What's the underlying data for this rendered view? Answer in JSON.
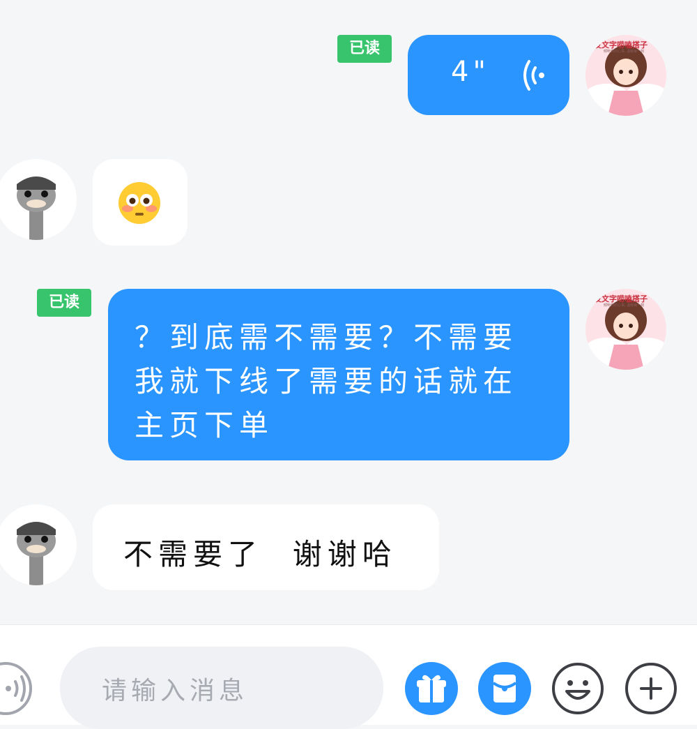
{
  "messages": [
    {
      "side": "out",
      "kind": "voice",
      "duration": "4\"",
      "status": "已读"
    },
    {
      "side": "in",
      "kind": "emoji",
      "emoji": "flushed-face-emoji"
    },
    {
      "side": "out",
      "kind": "text",
      "text": "？到底需不需要？不需要我就下线了需要的话就在主页下单",
      "status": "已读"
    },
    {
      "side": "in",
      "kind": "text",
      "text": "不需要了  谢谢哈"
    }
  ],
  "self_avatar": {
    "banner": "发文字唠嗑搭子",
    "sub": "倾听你的心事, 温暖每一刻"
  },
  "input": {
    "placeholder": "请输入消息"
  },
  "icons": {
    "voice": "voice-input-icon",
    "gift": "gift-icon",
    "red_packet": "red-packet-icon",
    "emoji": "emoji-icon",
    "plus": "plus-icon"
  },
  "colors": {
    "accent": "#2a94ff",
    "read": "#38c46d",
    "background": "#f5f6f8"
  }
}
